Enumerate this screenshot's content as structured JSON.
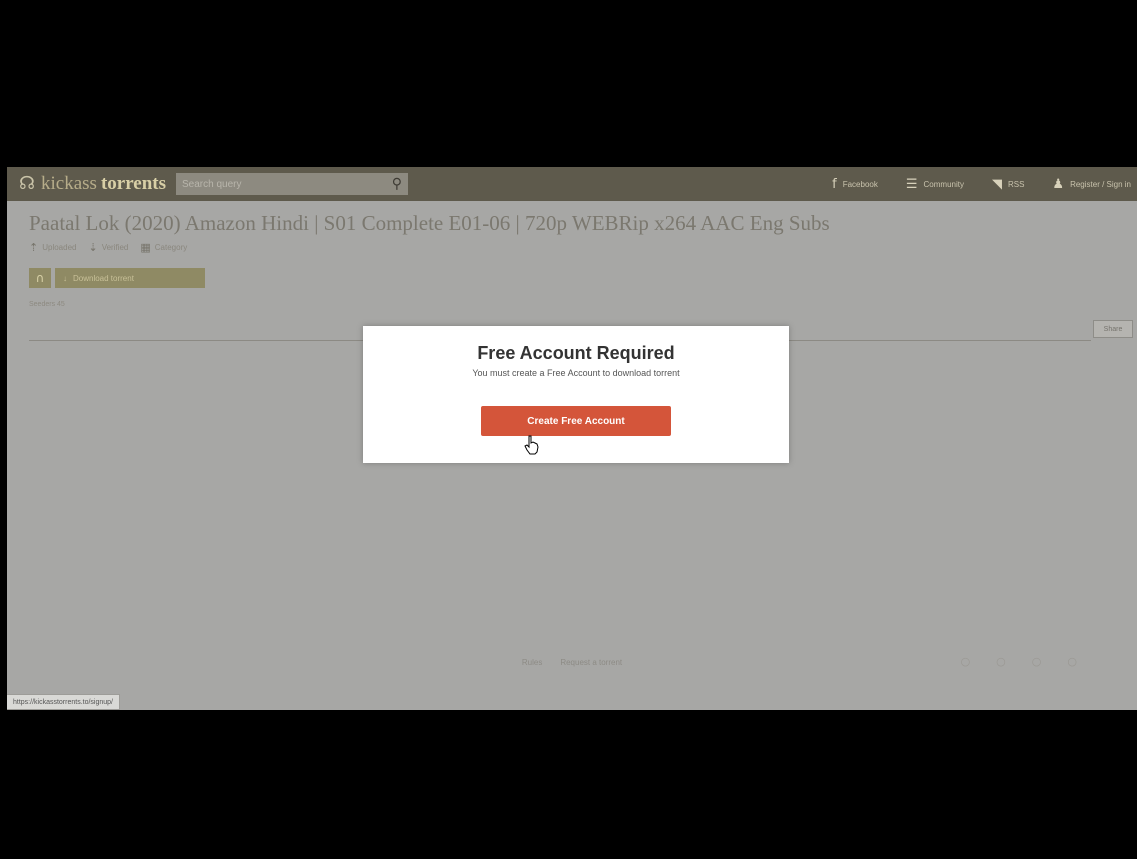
{
  "header": {
    "logo_part1": "kickass",
    "logo_part2": "torrents",
    "search_placeholder": "Search query",
    "nav": [
      {
        "icon": "facebook-icon",
        "label": "Facebook"
      },
      {
        "icon": "community-icon",
        "label": "Community"
      },
      {
        "icon": "rss-icon",
        "label": "RSS"
      },
      {
        "icon": "user-icon",
        "label": "Register / Sign in"
      }
    ]
  },
  "page": {
    "title": "Paatal Lok (2020) Amazon Hindi | S01 Complete E01-06 | 720p WEBRip x264 AAC Eng Subs",
    "meta": [
      "Uploaded",
      "Verified",
      "Category"
    ],
    "download_label": "Download torrent",
    "small_meta": "Seeders 45",
    "side_tab": "Share",
    "footer_links": [
      "Rules",
      "Request a torrent"
    ],
    "status_url": "https://kickasstorrents.to/signup/"
  },
  "modal": {
    "title": "Free Account Required",
    "text": "You must create a Free Account to download torrent",
    "button_label": "Create Free Account"
  },
  "colors": {
    "accent": "#d4553a",
    "header_bg": "#5e5a4c",
    "overlay_bg": "#a7a7a5"
  }
}
